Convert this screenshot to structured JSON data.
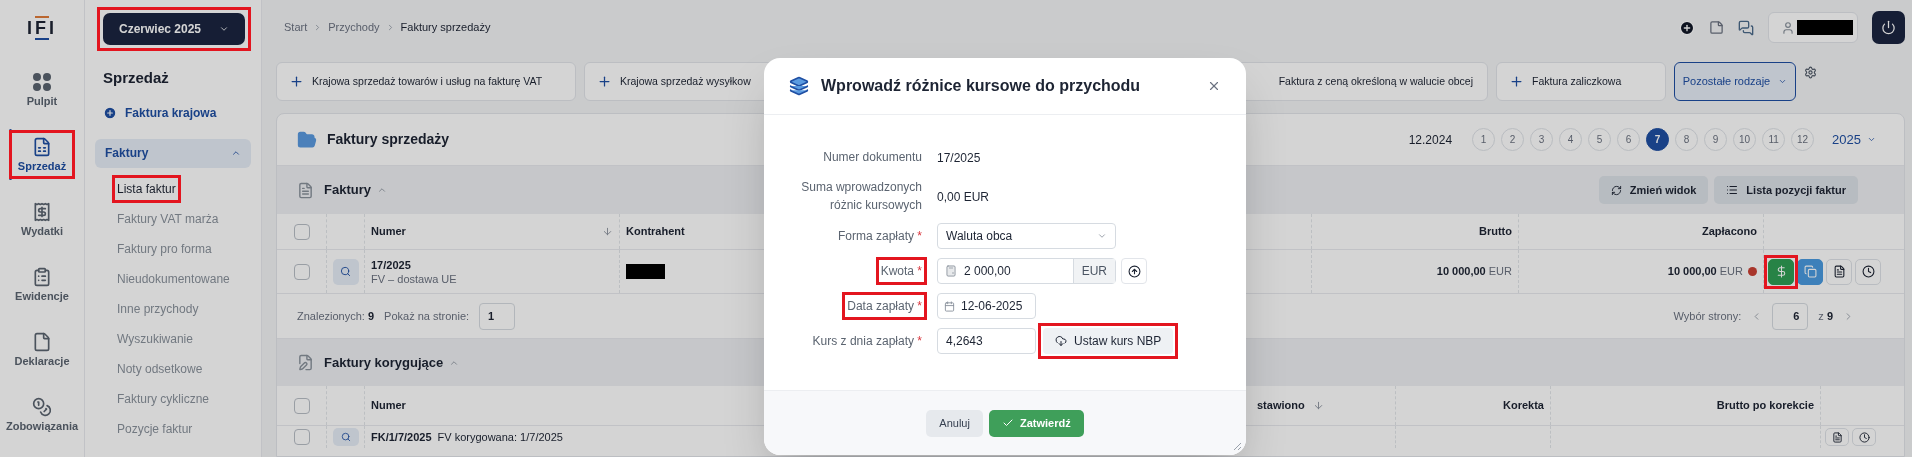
{
  "logo": "IFI",
  "rail": {
    "items": [
      {
        "kind": "dashboard",
        "label": "Pulpit",
        "selected": false,
        "highlighted": false
      },
      {
        "kind": "sales",
        "label": "Sprzedaż",
        "selected": true,
        "highlighted": true
      },
      {
        "kind": "expenses",
        "label": "Wydatki",
        "selected": false,
        "highlighted": false
      },
      {
        "kind": "records",
        "label": "Ewidencje",
        "selected": false,
        "highlighted": false
      },
      {
        "kind": "declarations",
        "label": "Deklaracje",
        "selected": false,
        "highlighted": false
      },
      {
        "kind": "liabilities",
        "label": "Zobowiązania",
        "selected": false,
        "highlighted": false
      }
    ]
  },
  "period_selector": {
    "label": "Czerwiec 2025",
    "highlighted": true
  },
  "submenu": {
    "title": "Sprzedaż",
    "action": "Faktura krajowa",
    "group": {
      "label": "Faktury",
      "expanded": true,
      "items": [
        {
          "label": "Lista faktur",
          "selected": true,
          "highlighted": true
        },
        {
          "label": "Faktury VAT marża",
          "selected": false,
          "highlighted": false
        },
        {
          "label": "Faktury pro forma",
          "selected": false,
          "highlighted": false
        },
        {
          "label": "Nieudokumentowane",
          "selected": false,
          "highlighted": false
        },
        {
          "label": "Inne przychody",
          "selected": false,
          "highlighted": false
        },
        {
          "label": "Wyszukiwanie",
          "selected": false,
          "highlighted": false
        },
        {
          "label": "Noty odsetkowe",
          "selected": false,
          "highlighted": false
        },
        {
          "label": "Faktury cykliczne",
          "selected": false,
          "highlighted": false
        },
        {
          "label": "Pozycje faktur",
          "selected": false,
          "highlighted": false
        }
      ]
    }
  },
  "breadcrumb": [
    "Start",
    "Przychody",
    "Faktury sprzedaży"
  ],
  "new_invoice_buttons": [
    "Krajowa sprzedaż towarów i usług na fakturę VAT",
    "Krajowa sprzedaż wysyłkow",
    "Faktura z ceną określoną w walucie obcej",
    "Faktura zaliczkowa"
  ],
  "more_button": "Pozostałe rodzaje",
  "panel": {
    "title": "Faktury sprzedaży",
    "previous_period": "12.2024",
    "year": "2025",
    "months": [
      {
        "label": "1",
        "selected": false
      },
      {
        "label": "2",
        "selected": false
      },
      {
        "label": "3",
        "selected": false
      },
      {
        "label": "4",
        "selected": false
      },
      {
        "label": "5",
        "selected": false
      },
      {
        "label": "6",
        "selected": false
      },
      {
        "label": "7",
        "selected": true
      },
      {
        "label": "8",
        "selected": false
      },
      {
        "label": "9",
        "selected": false
      },
      {
        "label": "10",
        "selected": false
      },
      {
        "label": "11",
        "selected": false
      },
      {
        "label": "12",
        "selected": false
      }
    ]
  },
  "invoices": {
    "title": "Faktury",
    "expanded": true,
    "buttons": [
      {
        "kind": "refresh",
        "label": "Zmień widok"
      },
      {
        "kind": "list",
        "label": "Lista pozycji faktur"
      }
    ],
    "all_checked": false,
    "columns": [
      "Numer",
      "Kontrahent",
      "Brutto",
      "Zapłacono"
    ],
    "rows": [
      {
        "checked": false,
        "number": "17/2025",
        "type": "FV – dostawa UE",
        "gross": "10 000,00",
        "gross_currency": "EUR",
        "paid": "10 000,00",
        "paid_currency": "EUR",
        "color": "#a8352b",
        "actions": [
          {
            "kind": "payment",
            "highlighted": true
          },
          {
            "kind": "copy",
            "highlighted": false
          },
          {
            "kind": "pdf",
            "highlighted": false
          },
          {
            "kind": "history",
            "highlighted": false
          }
        ]
      }
    ],
    "found_label": "Znalezionych:",
    "found": "9",
    "per_page_label": "Pokaż na stronie:",
    "per_page": "1",
    "page_label": "Wybór strony:",
    "page": "6",
    "of": "z",
    "pages": "9"
  },
  "corrections": {
    "title": "Faktury korygujące",
    "expanded": true,
    "all_checked": false,
    "columns": [
      "Numer",
      "stawiono",
      "Korekta",
      "Brutto po korekcie"
    ],
    "rows": [
      {
        "checked": false,
        "number": "FK/1/7/2025",
        "note": "FV korygowana: 1/7/2025",
        "actions": [
          {
            "kind": "pdf",
            "highlighted": false
          },
          {
            "kind": "history",
            "highlighted": false
          }
        ]
      }
    ]
  },
  "dialog": {
    "title": "Wprowadź różnice kursowe do przychodu",
    "fields": [
      {
        "kind": "text",
        "label": "Numer dokumentu",
        "value": "17/2025",
        "highlighted": false
      },
      {
        "kind": "text",
        "label": "Suma wprowadzonych różnic kursowych",
        "value": "0,00 EUR",
        "highlighted": false
      },
      {
        "kind": "select",
        "label": "Forma zapłaty",
        "required_mark": "*",
        "value": "Waluta obca",
        "highlighted": false
      },
      {
        "kind": "amount",
        "label": "Kwota",
        "required_mark": "*",
        "value": "2 000,00",
        "currency": "EUR",
        "highlighted": true
      },
      {
        "kind": "date",
        "label": "Data zapłaty",
        "required_mark": "*",
        "value": "12-06-2025",
        "highlighted": true
      },
      {
        "kind": "rate",
        "label": "Kurs z dnia zapłaty",
        "required_mark": "*",
        "value": "4,2643",
        "button": "Ustaw kurs NBP",
        "button_highlighted": true,
        "highlighted": false
      }
    ],
    "cancel": "Anuluj",
    "confirm": "Zatwierdź"
  }
}
